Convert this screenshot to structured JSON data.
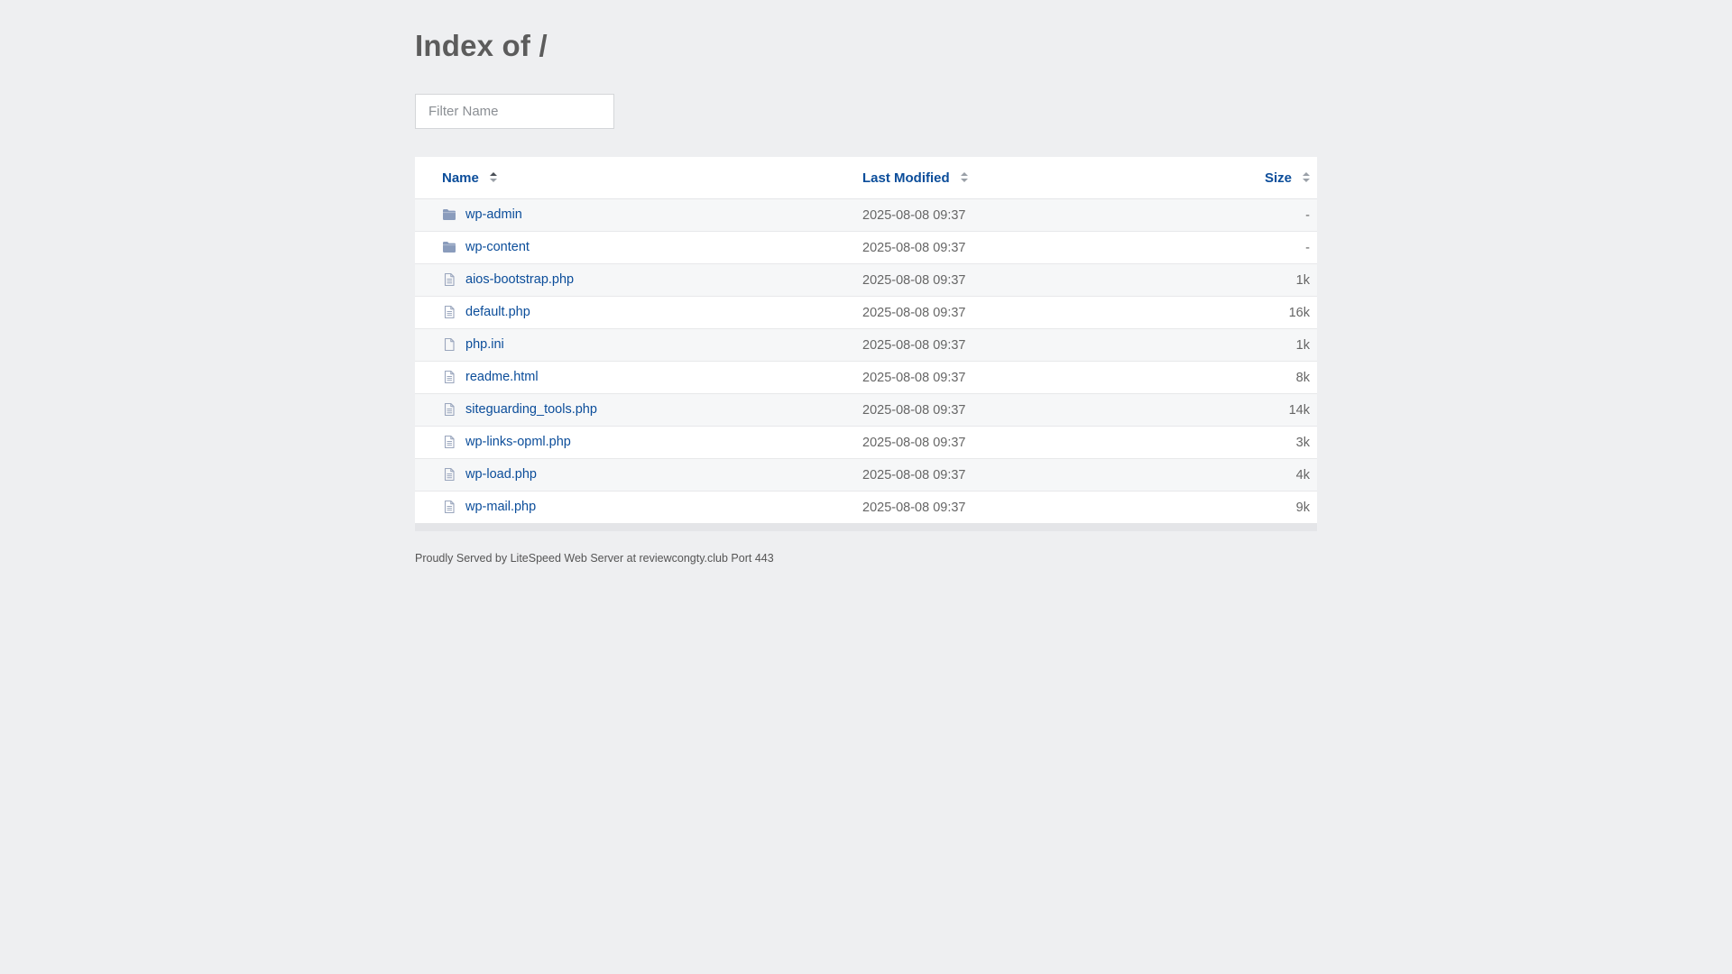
{
  "page": {
    "title": "Index of /",
    "filter_placeholder": "Filter Name",
    "footer": "Proudly Served by LiteSpeed Web Server at reviewcongty.club Port 443"
  },
  "columns": {
    "name": "Name",
    "modified": "Last Modified",
    "size": "Size"
  },
  "colors": {
    "link": "#0b4d9a",
    "background": "#eeeff1",
    "folder_icon": "#8a9cbc",
    "file_icon": "#9aa6bd"
  },
  "rows": [
    {
      "name": "wp-admin",
      "modified": "2025-08-08 09:37",
      "size": "-",
      "icon": "folder-icon"
    },
    {
      "name": "wp-content",
      "modified": "2025-08-08 09:37",
      "size": "-",
      "icon": "folder-icon"
    },
    {
      "name": "aios-bootstrap.php",
      "modified": "2025-08-08 09:37",
      "size": "1k",
      "icon": "file-text-icon"
    },
    {
      "name": "default.php",
      "modified": "2025-08-08 09:37",
      "size": "16k",
      "icon": "file-text-icon"
    },
    {
      "name": "php.ini",
      "modified": "2025-08-08 09:37",
      "size": "1k",
      "icon": "file-icon"
    },
    {
      "name": "readme.html",
      "modified": "2025-08-08 09:37",
      "size": "8k",
      "icon": "file-text-icon"
    },
    {
      "name": "siteguarding_tools.php",
      "modified": "2025-08-08 09:37",
      "size": "14k",
      "icon": "file-text-icon"
    },
    {
      "name": "wp-links-opml.php",
      "modified": "2025-08-08 09:37",
      "size": "3k",
      "icon": "file-text-icon"
    },
    {
      "name": "wp-load.php",
      "modified": "2025-08-08 09:37",
      "size": "4k",
      "icon": "file-text-icon"
    },
    {
      "name": "wp-mail.php",
      "modified": "2025-08-08 09:37",
      "size": "9k",
      "icon": "file-text-icon"
    }
  ]
}
